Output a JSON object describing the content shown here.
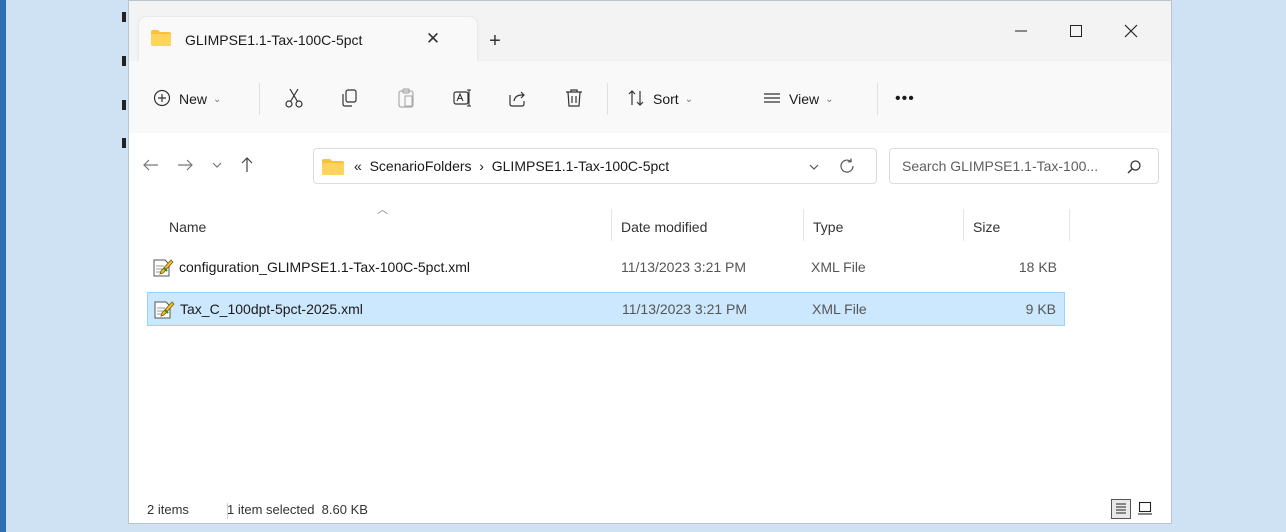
{
  "tab": {
    "title": "GLIMPSE1.1-Tax-100C-5pct",
    "close": "✕",
    "add": "+"
  },
  "window_controls": {
    "minimize": "—",
    "maximize": "☐",
    "close": "✕"
  },
  "toolbar": {
    "new_label": "New",
    "sort_label": "Sort",
    "view_label": "View",
    "more_label": "•••"
  },
  "address": {
    "prefix": "«",
    "path": [
      "ScenarioFolders",
      "GLIMPSE1.1-Tax-100C-5pct"
    ],
    "separator": "›"
  },
  "search": {
    "placeholder": "Search GLIMPSE1.1-Tax-100..."
  },
  "columns": {
    "name": "Name",
    "date": "Date modified",
    "type": "Type",
    "size": "Size"
  },
  "files": [
    {
      "name": "configuration_GLIMPSE1.1-Tax-100C-5pct.xml",
      "date": "11/13/2023 3:21 PM",
      "type": "XML File",
      "size": "18 KB",
      "selected": false
    },
    {
      "name": "Tax_C_100dpt-5pct-2025.xml",
      "date": "11/13/2023 3:21 PM",
      "type": "XML File",
      "size": "9 KB",
      "selected": true
    }
  ],
  "status": {
    "items": "2 items",
    "selection": "1 item selected  8.60 KB"
  },
  "colors": {
    "selection": "#cce8ff",
    "selection_border": "#99d1ff",
    "folder": "#f8c33a",
    "desktop": "#cfe2f3"
  },
  "icons": [
    "folder-icon",
    "cut-icon",
    "copy-icon",
    "paste-icon",
    "rename-icon",
    "share-icon",
    "delete-icon",
    "sort-icon",
    "view-icon",
    "search-icon",
    "refresh-icon",
    "xml-file-icon"
  ]
}
